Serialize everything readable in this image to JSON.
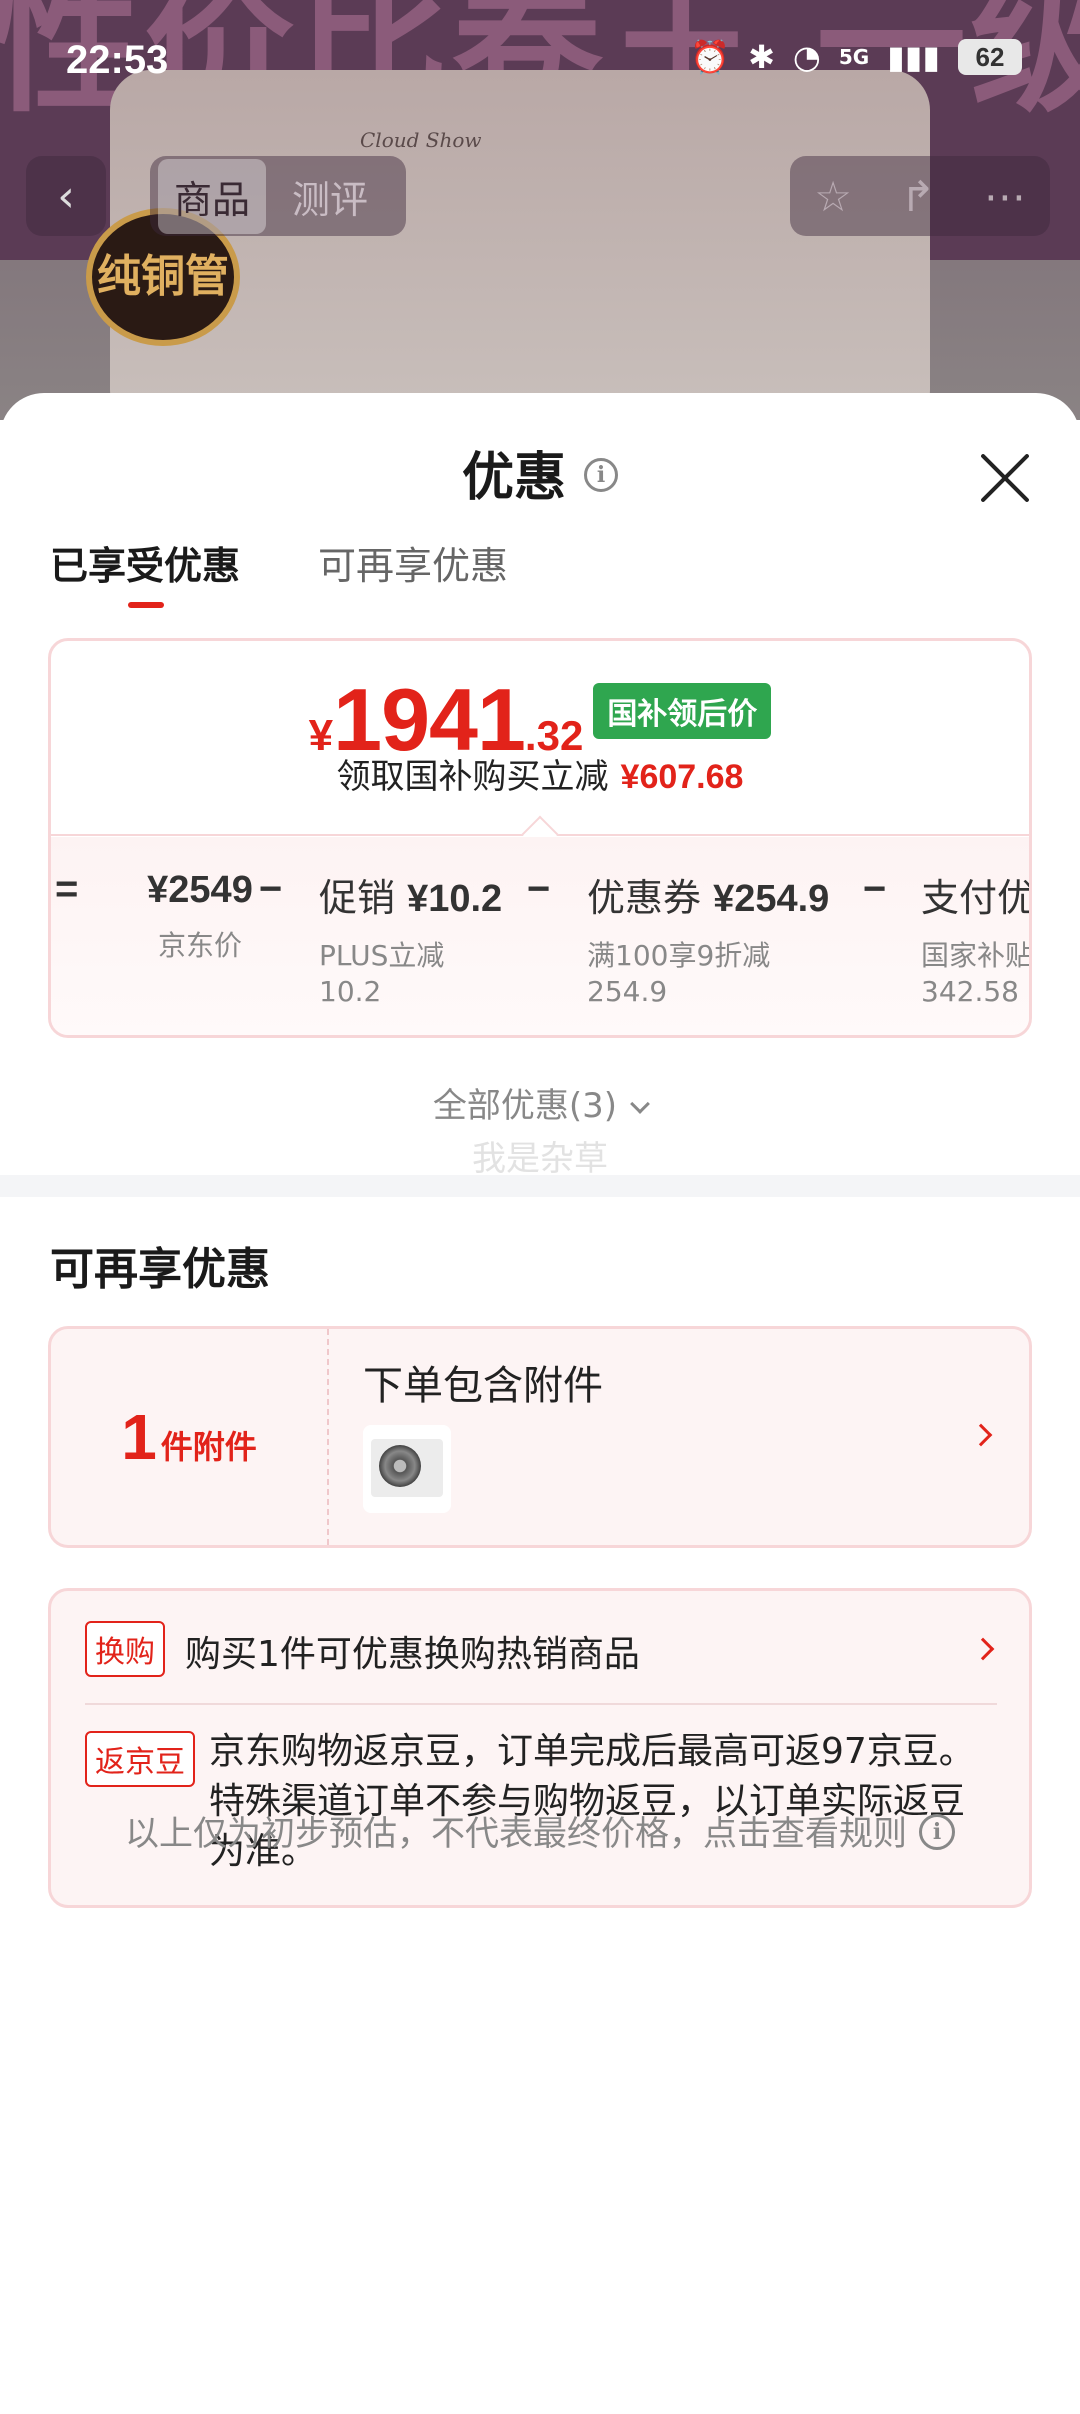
{
  "status_bar": {
    "time": "22:53",
    "network": "5G",
    "battery": "62"
  },
  "background": {
    "banner_text": "性价比卷王 一级省电",
    "brand": "Cloud Show",
    "badge": "纯铜管",
    "nav_tabs": [
      "商品",
      "测评"
    ]
  },
  "sheet": {
    "title": "优惠",
    "tabs": [
      "已享受优惠",
      "可再享优惠"
    ],
    "price": {
      "currency": "¥",
      "integer": "1941",
      "decimal": ".32",
      "tag": "国补领后价",
      "subtitle": "领取国补购买立减",
      "savings": "¥607.68"
    },
    "breakdown": {
      "symbols": [
        "=",
        "−",
        "−",
        "−"
      ],
      "items": [
        {
          "value_prefix": "",
          "value": "¥2549",
          "label_lines": [
            "京东价"
          ]
        },
        {
          "value_prefix": "促销 ",
          "value": "¥10.2",
          "label_lines": [
            "PLUS立减",
            "10.2"
          ]
        },
        {
          "value_prefix": "优惠券 ",
          "value": "¥254.9",
          "label_lines": [
            "满100享9折减",
            "254.9"
          ]
        },
        {
          "value_prefix": "支付优",
          "value": "",
          "label_lines": [
            "国家补贴",
            "342.58"
          ]
        }
      ]
    },
    "all_offers": "全部优惠(3)",
    "watermark": "我是杂草",
    "more_section": {
      "title": "可再享优惠",
      "accessory": {
        "count": "1",
        "unit": "件附件",
        "title": "下单包含附件"
      },
      "promos": [
        {
          "tag": "换购",
          "text": "购买1件可优惠换购热销商品"
        },
        {
          "tag": "返京豆",
          "text": "京东购物返京豆，订单完成后最高可返97京豆。特殊渠道订单不参与购物返豆，以订单实际返豆为准。"
        }
      ]
    },
    "footer_note": "以上仅为初步预估，不代表最终价格，点击查看规则"
  },
  "colors": {
    "accent_red": "#e2231a",
    "tag_green": "#2fa64f",
    "card_border": "#f7d6d8"
  }
}
